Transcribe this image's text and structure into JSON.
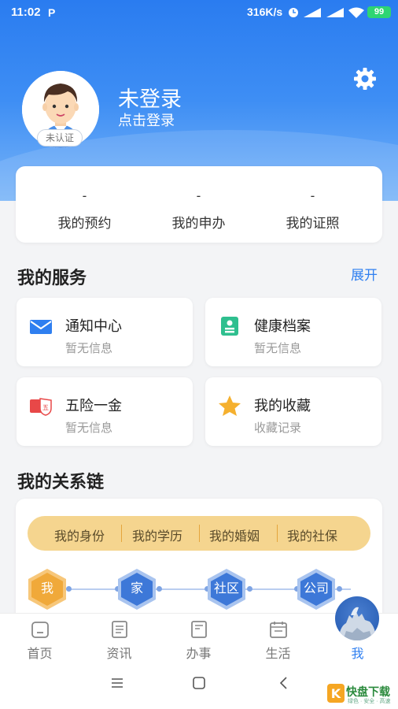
{
  "status_bar": {
    "time": "11:02",
    "app_badge": "P",
    "network_speed": "316K/s",
    "battery": "99"
  },
  "profile": {
    "name": "未登录",
    "login_prompt": "点击登录",
    "verify_badge": "未认证"
  },
  "stats": [
    {
      "value": "-",
      "label": "我的预约"
    },
    {
      "value": "-",
      "label": "我的申办"
    },
    {
      "value": "-",
      "label": "我的证照"
    }
  ],
  "services": {
    "title": "我的服务",
    "expand_label": "展开",
    "items": [
      {
        "title": "通知中心",
        "subtitle": "暂无信息",
        "icon": "envelope-icon"
      },
      {
        "title": "健康档案",
        "subtitle": "暂无信息",
        "icon": "health-record-icon"
      },
      {
        "title": "五险一金",
        "subtitle": "暂无信息",
        "icon": "insurance-card-icon",
        "icon_text": "五"
      },
      {
        "title": "我的收藏",
        "subtitle": "收藏记录",
        "icon": "star-icon"
      }
    ]
  },
  "relations": {
    "title": "我的关系链",
    "tabs": [
      "我的身份",
      "我的学历",
      "我的婚姻",
      "我的社保"
    ],
    "chain": [
      "我",
      "家",
      "社区",
      "公司"
    ]
  },
  "tabbar": {
    "items": [
      {
        "label": "首页",
        "icon": "home-icon"
      },
      {
        "label": "资讯",
        "icon": "news-icon"
      },
      {
        "label": "办事",
        "icon": "affairs-icon"
      },
      {
        "label": "生活",
        "icon": "calendar-icon"
      },
      {
        "label": "我",
        "icon": "mascot-icon",
        "active": true
      }
    ]
  },
  "watermark": {
    "text": "快盘下载",
    "sub": "绿色 · 安全 · 高速",
    "logo_letter": "K"
  },
  "colors": {
    "primary": "#2f7ff0",
    "gold": "#f5d58f",
    "hex_orange": "#f0a93a",
    "hex_blue": "#3d78d8"
  }
}
